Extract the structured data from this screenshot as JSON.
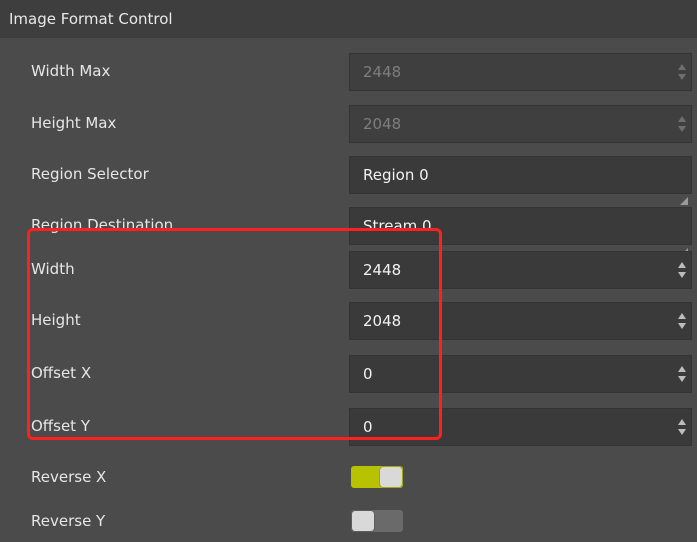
{
  "section": {
    "title": "Image Format Control"
  },
  "rows": [
    {
      "label": "Width Max",
      "value": "2448",
      "kind": "spin",
      "enabled": false
    },
    {
      "label": "Height Max",
      "value": "2048",
      "kind": "spin",
      "enabled": false
    },
    {
      "label": "Region Selector",
      "value": "Region 0",
      "kind": "combo",
      "enabled": true
    },
    {
      "label": "Region Destination",
      "value": "Stream 0",
      "kind": "combo",
      "enabled": true
    },
    {
      "label": "Width",
      "value": "2448",
      "kind": "spin",
      "enabled": true
    },
    {
      "label": "Height",
      "value": "2048",
      "kind": "spin",
      "enabled": true
    },
    {
      "label": "Offset X",
      "value": "0",
      "kind": "spin",
      "enabled": true
    },
    {
      "label": "Offset Y",
      "value": "0",
      "kind": "spin",
      "enabled": true
    },
    {
      "label": "Reverse X",
      "kind": "toggle",
      "state": "on"
    },
    {
      "label": "Reverse Y",
      "kind": "toggle",
      "state": "off"
    }
  ],
  "colors": {
    "toggle_on": "#b7c200",
    "highlight_border": "#ff2020"
  }
}
